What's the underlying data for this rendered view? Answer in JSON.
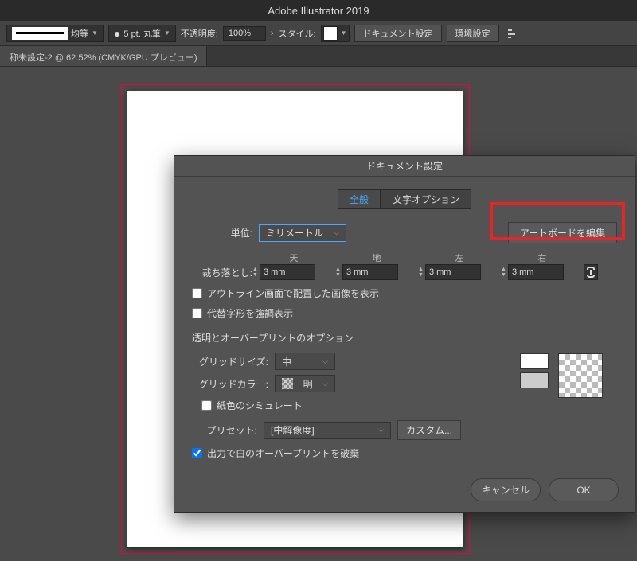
{
  "app": {
    "title": "Adobe Illustrator 2019"
  },
  "optbar": {
    "stroke_style": "均等",
    "brush": "5 pt. 丸筆",
    "opacity_label": "不透明度:",
    "opacity_value": "100%",
    "style_label": "スタイル:",
    "doc_setup_label": "ドキュメント設定",
    "prefs_label": "環境設定"
  },
  "doc": {
    "tab": "称未設定-2 @ 62.52% (CMYK/GPU プレビュー)"
  },
  "dlg": {
    "title": "ドキュメント設定",
    "tab_general": "全般",
    "tab_type": "文字オプション",
    "units_label": "単位:",
    "units_value": "ミリメートル",
    "edit_artboard": "アートボードを編集",
    "bleed": {
      "label": "裁ち落とし:",
      "top_lbl": "天",
      "bottom_lbl": "地",
      "left_lbl": "左",
      "right_lbl": "右",
      "top": "3 mm",
      "bottom": "3 mm",
      "left": "3 mm",
      "right": "3 mm"
    },
    "show_placed_outline": "アウトライン画面で配置した画像を表示",
    "highlight_sub_glyphs": "代替字形を強調表示",
    "transp_heading": "透明とオーバープリントのオプション",
    "grid_size_label": "グリッドサイズ:",
    "grid_size_value": "中",
    "grid_color_label": "グリッドカラー:",
    "grid_color_value": "明",
    "simulate_paper": "紙色のシミュレート",
    "preset_label": "プリセット:",
    "preset_value": "[中解像度]",
    "custom_label": "カスタム...",
    "discard_white_op": "出力で白のオーバープリントを破棄",
    "cancel": "キャンセル",
    "ok": "OK"
  }
}
